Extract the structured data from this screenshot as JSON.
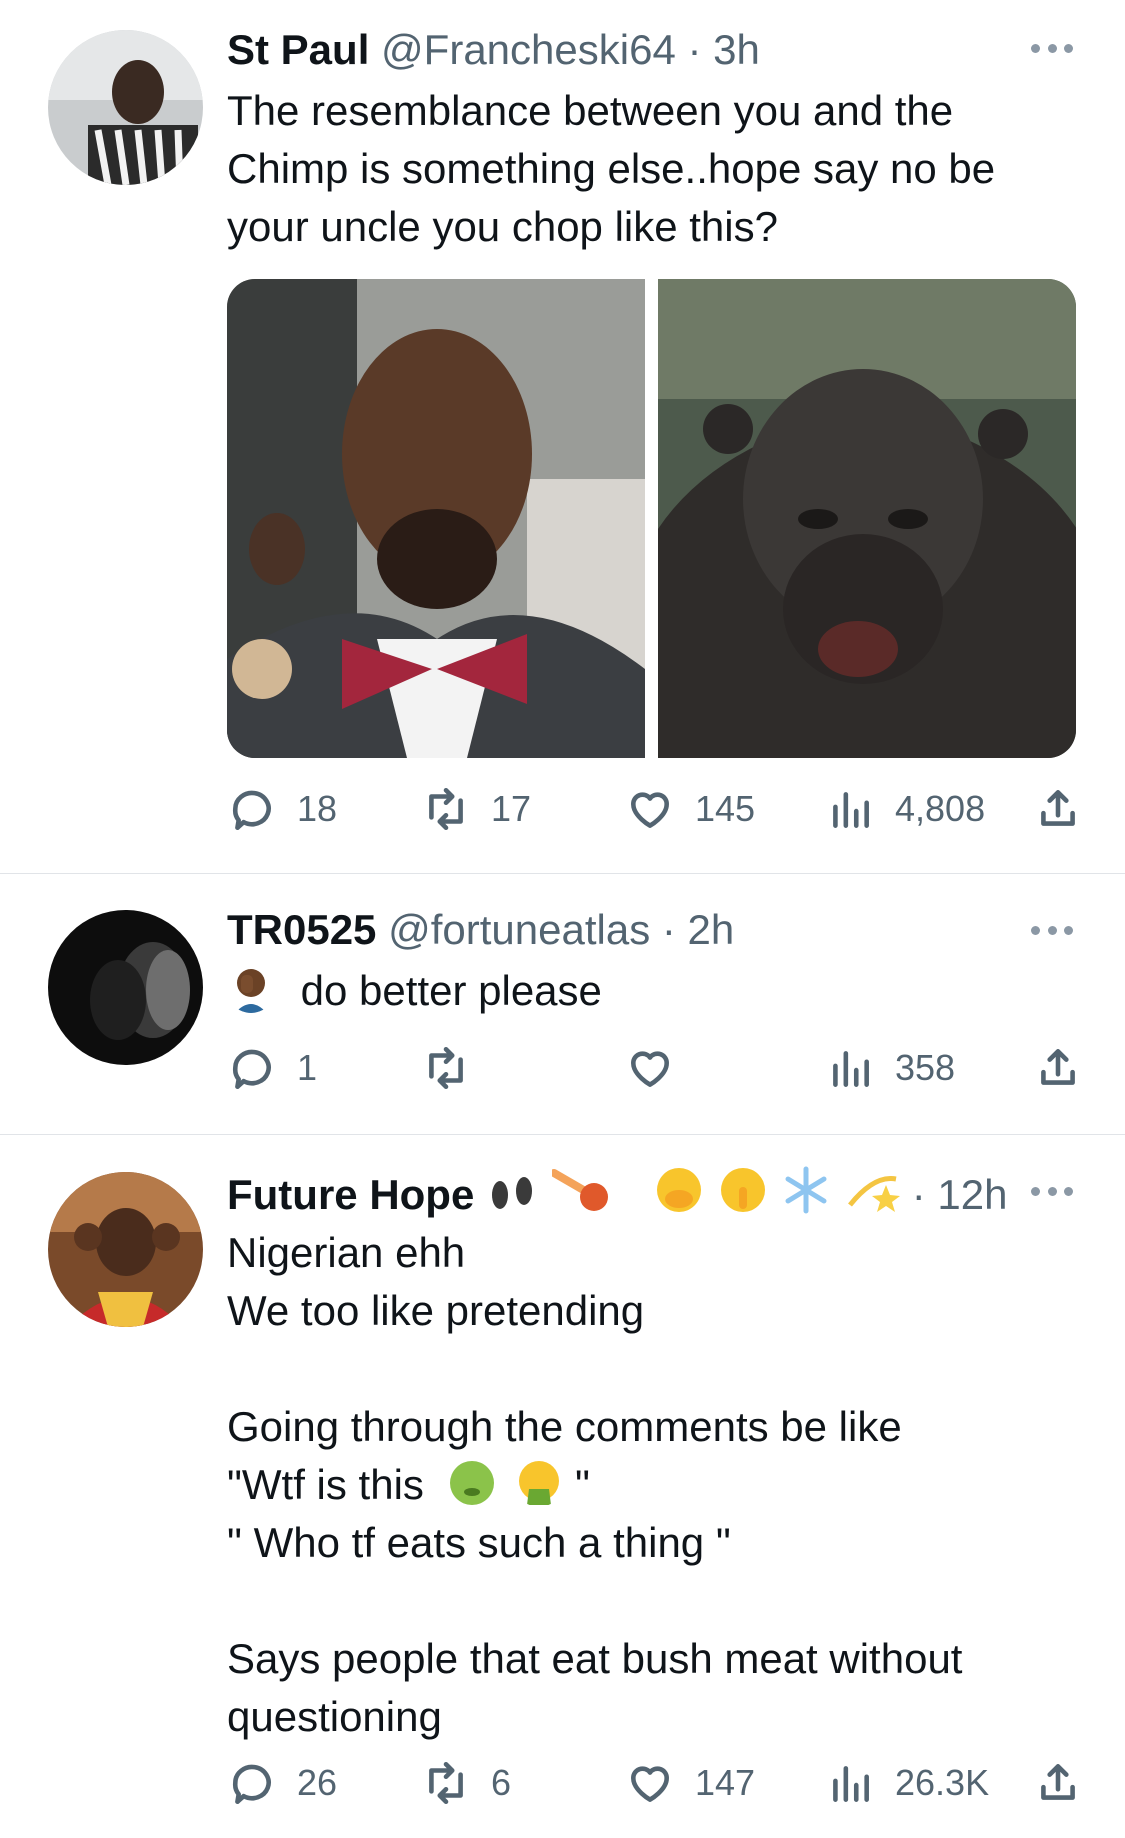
{
  "tweets": [
    {
      "name": "St Paul",
      "handle": "@Francheski64",
      "time": "· 3h",
      "text": [
        "The resemblance between you and the",
        "Chimp is something else..hope say no be",
        "your uncle you chop like this?"
      ],
      "replies": "18",
      "retweets": "17",
      "likes": "145",
      "views": "4,808"
    },
    {
      "name": "TR0525",
      "handle": "@fortuneatlas",
      "time": "· 2h",
      "text": [
        "do better please"
      ],
      "replies": "1",
      "retweets": "",
      "likes": "",
      "views": "358"
    },
    {
      "name": "Future Hope",
      "handle": "",
      "time": "· 12h",
      "text": [
        "Nigerian ehh",
        "We too like pretending",
        "",
        "Going through the comments be like",
        "\"Wtf is this",
        "\" Who tf eats such a thing \"",
        "",
        "Says people that eat bush meat without",
        "questioning"
      ],
      "text_suffix_line5": "\"",
      "replies": "26",
      "retweets": "6",
      "likes": "147",
      "views": "26.3K"
    }
  ],
  "icons": {
    "reply": "speech-bubble-icon",
    "retweet": "retweet-arrows-icon",
    "like": "heart-icon",
    "views": "bar-chart-icon",
    "share": "share-upload-icon",
    "more": "ellipsis-icon"
  },
  "colors": {
    "text": "#0f1419",
    "secondary": "#536471",
    "divider": "#e1e4e8"
  }
}
